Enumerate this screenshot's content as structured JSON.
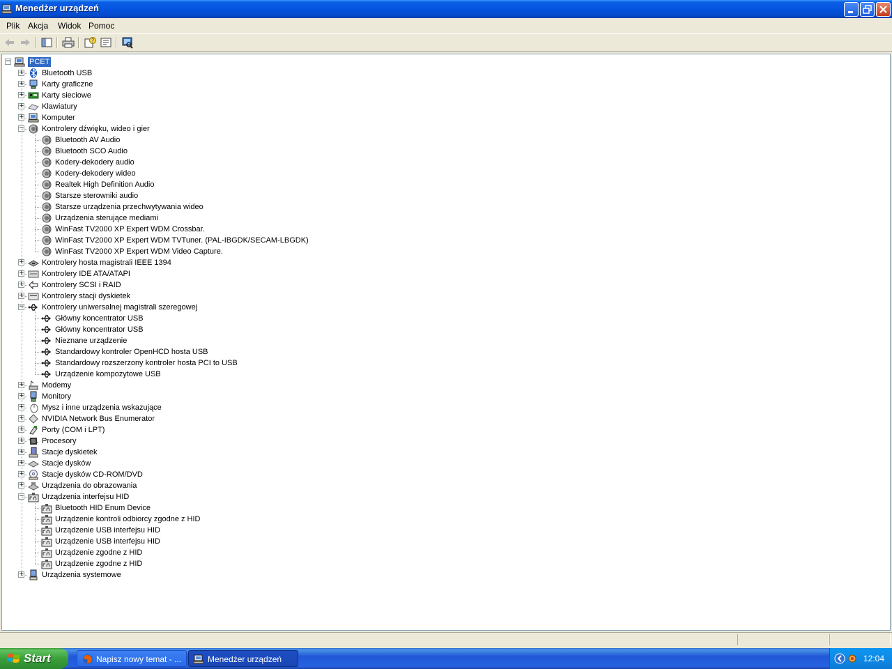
{
  "window": {
    "title": "Menedżer urządzeń",
    "minimize_icon": "minimize-icon",
    "maximize_icon": "restore-icon",
    "close_icon": "close-icon"
  },
  "menu": [
    "Plik",
    "Akcja",
    "Widok",
    "Pomoc"
  ],
  "toolbar": {
    "buttons": [
      "back-arrow-icon",
      "forward-arrow-icon",
      "show-hide-tree-icon",
      "print-icon",
      "properties-help-icon",
      "properties-icon",
      "scan-hardware-icon"
    ]
  },
  "tree": {
    "root": "PCET",
    "categories": [
      {
        "label": "Bluetooth USB",
        "expanded": false,
        "icon": "bluetooth-icon",
        "children": []
      },
      {
        "label": "Karty graficzne",
        "expanded": false,
        "icon": "display-adapter-icon",
        "children": []
      },
      {
        "label": "Karty sieciowe",
        "expanded": false,
        "icon": "network-card-icon",
        "children": []
      },
      {
        "label": "Klawiatury",
        "expanded": false,
        "icon": "keyboard-icon",
        "children": []
      },
      {
        "label": "Komputer",
        "expanded": false,
        "icon": "computer-icon",
        "children": []
      },
      {
        "label": "Kontrolery dźwięku, wideo i gier",
        "expanded": true,
        "icon": "sound-icon",
        "children": [
          "Bluetooth AV Audio",
          "Bluetooth SCO Audio",
          "Kodery-dekodery audio",
          "Kodery-dekodery wideo",
          "Realtek High Definition Audio",
          "Starsze sterowniki audio",
          "Starsze urządzenia przechwytywania wideo",
          "Urządzenia sterujące mediami",
          "WinFast TV2000 XP Expert WDM Crossbar.",
          "WinFast TV2000 XP Expert WDM TVTuner. (PAL-IBGDK/SECAM-LBGDK)",
          "WinFast TV2000 XP Expert WDM Video Capture."
        ]
      },
      {
        "label": "Kontrolery hosta magistrali IEEE 1394",
        "expanded": false,
        "icon": "ieee1394-icon",
        "children": []
      },
      {
        "label": "Kontrolery IDE ATA/ATAPI",
        "expanded": false,
        "icon": "ide-controller-icon",
        "children": []
      },
      {
        "label": "Kontrolery SCSI i RAID",
        "expanded": false,
        "icon": "scsi-icon",
        "children": []
      },
      {
        "label": "Kontrolery stacji dyskietek",
        "expanded": false,
        "icon": "floppy-controller-icon",
        "children": []
      },
      {
        "label": "Kontrolery uniwersalnej magistrali szeregowej",
        "expanded": true,
        "icon": "usb-icon",
        "children": [
          "Główny koncentrator USB",
          "Główny koncentrator USB",
          "Nieznane urządzenie",
          "Standardowy kontroler OpenHCD hosta USB",
          "Standardowy rozszerzony kontroler hosta PCI to USB",
          "Urządzenie kompozytowe USB"
        ]
      },
      {
        "label": "Modemy",
        "expanded": false,
        "icon": "modem-icon",
        "children": []
      },
      {
        "label": "Monitory",
        "expanded": false,
        "icon": "monitor-icon",
        "children": []
      },
      {
        "label": "Mysz i inne urządzenia wskazujące",
        "expanded": false,
        "icon": "mouse-icon",
        "children": []
      },
      {
        "label": "NVIDIA Network Bus Enumerator",
        "expanded": false,
        "icon": "network-bus-icon",
        "children": []
      },
      {
        "label": "Porty (COM i LPT)",
        "expanded": false,
        "icon": "port-icon",
        "children": []
      },
      {
        "label": "Procesory",
        "expanded": false,
        "icon": "processor-icon",
        "children": []
      },
      {
        "label": "Stacje dyskietek",
        "expanded": false,
        "icon": "floppy-drive-icon",
        "children": []
      },
      {
        "label": "Stacje dysków",
        "expanded": false,
        "icon": "disk-drive-icon",
        "children": []
      },
      {
        "label": "Stacje dysków CD-ROM/DVD",
        "expanded": false,
        "icon": "cdrom-icon",
        "children": []
      },
      {
        "label": "Urządzenia do obrazowania",
        "expanded": false,
        "icon": "imaging-icon",
        "children": []
      },
      {
        "label": "Urządzenia interfejsu HID",
        "expanded": true,
        "icon": "hid-icon",
        "children": [
          "Bluetooth HID Enum Device",
          "Urządzenie kontroli odbiorcy zgodne z HID",
          "Urządzenie USB interfejsu HID",
          "Urządzenie USB interfejsu HID",
          "Urządzenie zgodne z HID",
          "Urządzenie zgodne z HID"
        ]
      },
      {
        "label": "Urządzenia systemowe",
        "expanded": false,
        "icon": "system-device-icon",
        "children": []
      }
    ]
  },
  "taskbar": {
    "start_label": "Start",
    "items": [
      {
        "label": "Napisz nowy temat - ...",
        "icon": "firefox-icon",
        "active": false
      },
      {
        "label": "Menedżer urządzeń",
        "icon": "device-manager-icon",
        "active": true
      }
    ],
    "clock": "12:04"
  },
  "colors": {
    "titlebar": "#0554e0",
    "selection": "#316ac5",
    "taskbar": "#2157d7",
    "start": "#3a9f3a",
    "tray": "#0f8ae6"
  }
}
